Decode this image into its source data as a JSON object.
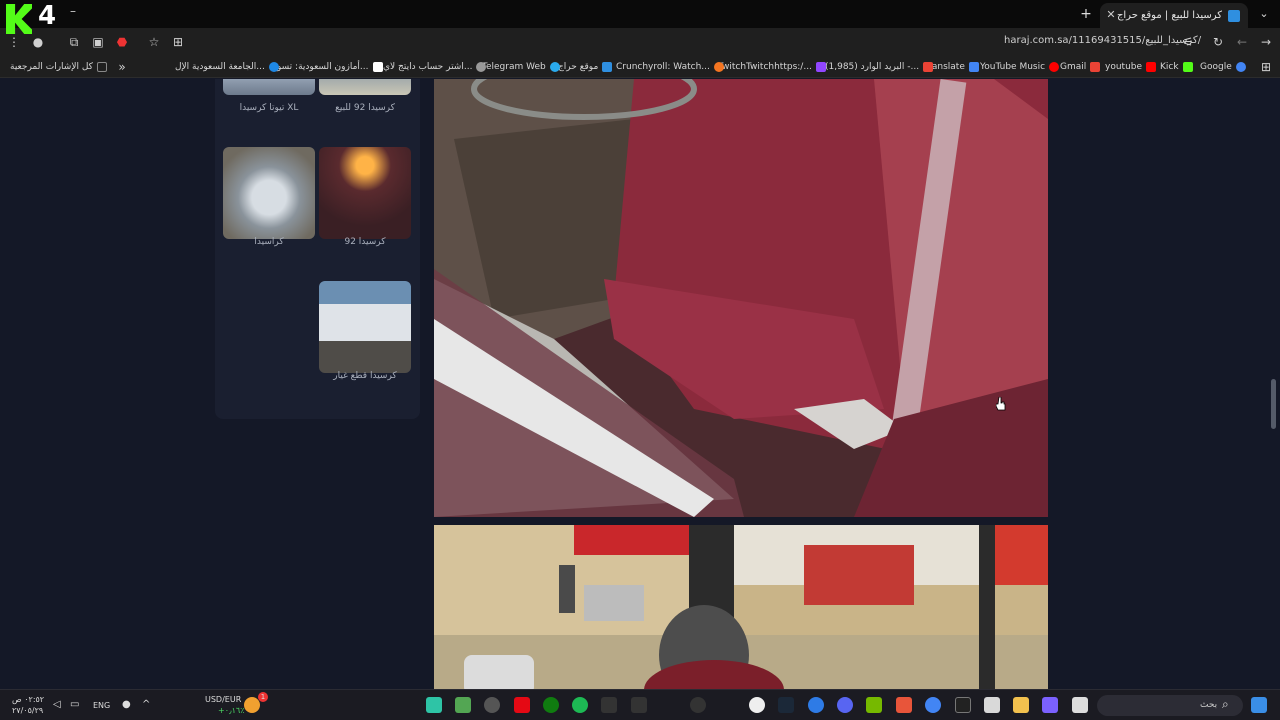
{
  "browser": {
    "tab_title": "كرسيدا للبيع | موقع حراج",
    "url": "haraj.com.sa/11169431515/كرسيدا_للبيع/",
    "logo_text": "4"
  },
  "bookmarks": [
    {
      "label": "Google",
      "color": "#4285f4"
    },
    {
      "label": "Kick",
      "color": "#53fc18"
    },
    {
      "label": "youtube",
      "color": "#ff0000"
    },
    {
      "label": "Gmail",
      "color": "#ea4335"
    },
    {
      "label": "YouTube Music",
      "color": "#ff0000"
    },
    {
      "label": "Translate",
      "color": "#4285f4"
    },
    {
      "label": "البريد الوارد (1,985) -...",
      "color": "#ea4335"
    },
    {
      "label": "TwitchTwitchhttps:/...",
      "color": "#9146ff"
    },
    {
      "label": "Crunchyroll: Watch...",
      "color": "#f47521"
    },
    {
      "label": "موقع حراج",
      "color": "#2f8fe0"
    },
    {
      "label": "Telegram Web",
      "color": "#2aabee"
    },
    {
      "label": "اشتر حساب دايتج لاي...",
      "color": "#999999"
    },
    {
      "label": "أمازون السعودية: تسو...",
      "color": "#ffffff"
    },
    {
      "label": "الجامعة السعودية الإل...",
      "color": "#1e88e5"
    },
    {
      "label": "كل الإشارات المرجعية",
      "color": "#888888"
    }
  ],
  "sidebar": {
    "thumbs": [
      {
        "caption": "كرسيدا 92 للبيع"
      },
      {
        "caption": "تيوتا كرسيدا XL"
      },
      {
        "caption": "كرسيدا 92"
      },
      {
        "caption": "كراسيدا"
      },
      {
        "caption": "كرسيدا قطع غيار"
      }
    ]
  },
  "taskbar": {
    "search_label": "بحث",
    "currency": "USD/EUR",
    "currency_change": "+٠٫١٦٪",
    "lang": "ENG",
    "time": "٠٢:٥٢ ص",
    "date": "٢٧/٠٥/٢٩",
    "notif_count": "1"
  },
  "colors": {
    "page_bg": "#141827",
    "panel_bg": "#1a1f30",
    "seat_red": "#8b2a3c"
  }
}
